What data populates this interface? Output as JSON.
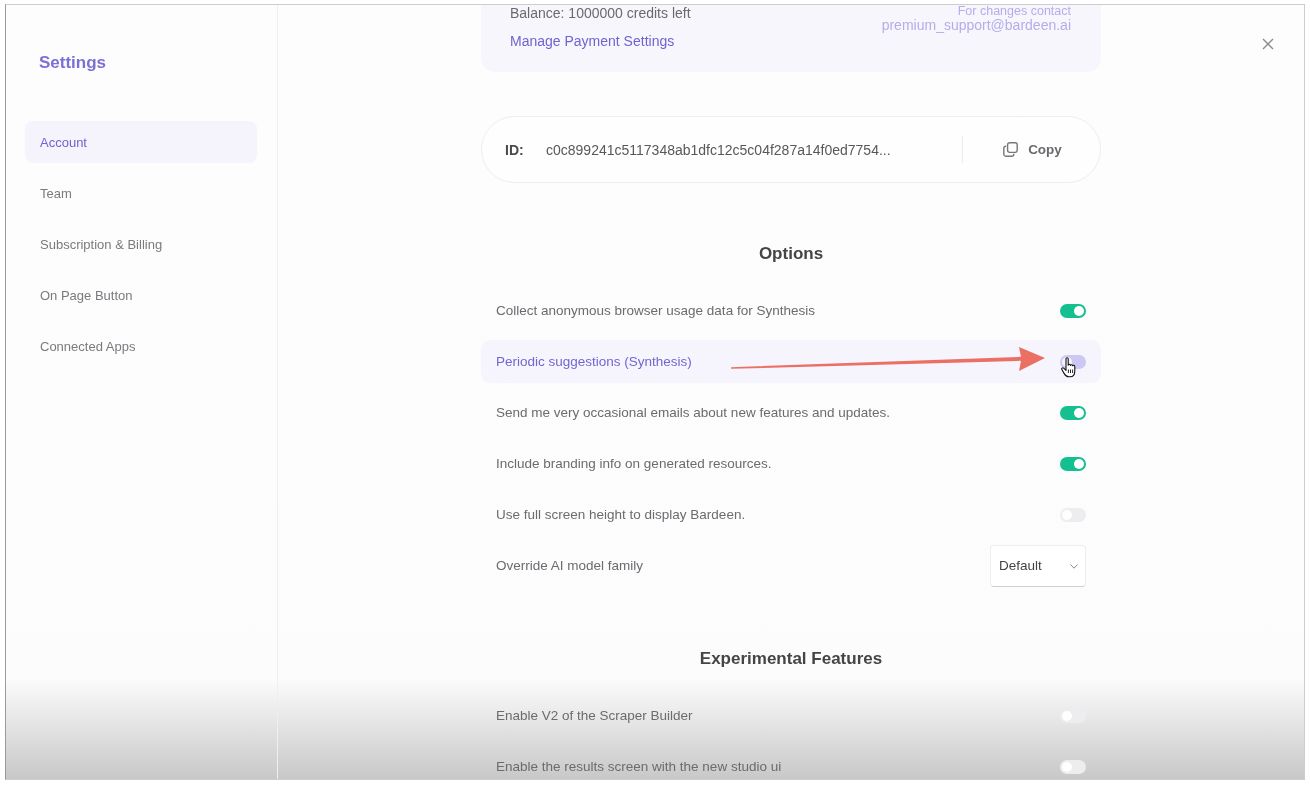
{
  "sidebar": {
    "title": "Settings",
    "items": [
      {
        "label": "Account",
        "selected": true
      },
      {
        "label": "Team",
        "selected": false
      },
      {
        "label": "Subscription & Billing",
        "selected": false
      },
      {
        "label": "On Page Button",
        "selected": false
      },
      {
        "label": "Connected Apps",
        "selected": false
      }
    ]
  },
  "payment_card": {
    "balance": "Balance: 1000000 credits left",
    "link": "Manage Payment Settings",
    "contact_label": "For changes contact",
    "contact_email": "premium_support@bardeen.ai"
  },
  "id_card": {
    "label": "ID:",
    "value": "c0c899241c5117348ab1dfc12c5c04f287a14f0ed7754...",
    "copy_button": "Copy"
  },
  "options": {
    "title": "Options",
    "rows": [
      {
        "kind": "toggle",
        "label": "Collect anonymous browser usage data for Synthesis",
        "on": true,
        "highlighted": false
      },
      {
        "kind": "toggle",
        "label": "Periodic suggestions (Synthesis)",
        "on": false,
        "highlighted": true
      },
      {
        "kind": "toggle",
        "label": "Send me very occasional emails about new features and updates.",
        "on": true,
        "highlighted": false
      },
      {
        "kind": "toggle",
        "label": "Include branding info on generated resources.",
        "on": true,
        "highlighted": false
      },
      {
        "kind": "toggle",
        "label": "Use full screen height to display Bardeen.",
        "on": false,
        "highlighted": false
      },
      {
        "kind": "dropdown",
        "label": "Override AI model family",
        "value": "Default",
        "highlighted": false
      }
    ]
  },
  "experimental": {
    "title": "Experimental Features",
    "rows": [
      {
        "kind": "toggle",
        "label": "Enable V2 of the Scraper Builder",
        "on": false,
        "highlighted": false
      },
      {
        "kind": "toggle",
        "label": "Enable the results screen with the new studio ui",
        "on": false,
        "highlighted": false
      }
    ]
  }
}
